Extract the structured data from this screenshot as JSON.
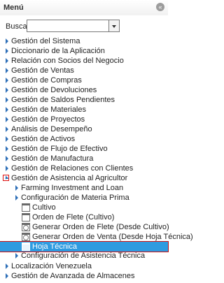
{
  "header": {
    "title": "Menú",
    "collapse_icon": "close-circle-icon"
  },
  "search": {
    "label": "Buscar:",
    "value": ""
  },
  "tree": {
    "top_items": [
      "Gestión del Sistema",
      "Diccionario de la Aplicación",
      "Relación con Socios del Negocio",
      "Gestión de Ventas",
      "Gestión de Compras",
      "Gestión de Devoluciones",
      "Gestión de Saldos Pendientes",
      "Gestión de Materiales",
      "Gestión de Proyectos",
      "Análisis de Desempeño",
      "Gestión de Activos",
      "Gestión de Flujo de Efectivo",
      "Gestión de Manufactura",
      "Gestión de Relaciones con Clientes"
    ],
    "open_item": "Gestión de Asistencia al Agricultor",
    "sub_items": [
      "Farming Investment and Loan",
      "Configuración de Materia Prima"
    ],
    "leaf_items": [
      "Cultivo",
      "Orden de Flete (Cultivo)",
      "Generar Orden de Flete (Desde Cultivo)",
      "Generar Orden de Venta (Desde Hoja Técnica)",
      "Hoja Técnica"
    ],
    "after_sub": "Configuración de Asistencia Técnica",
    "bottom_items": [
      "Localización Venezuela",
      "Gestión de Avanzada de Almacenes"
    ]
  }
}
